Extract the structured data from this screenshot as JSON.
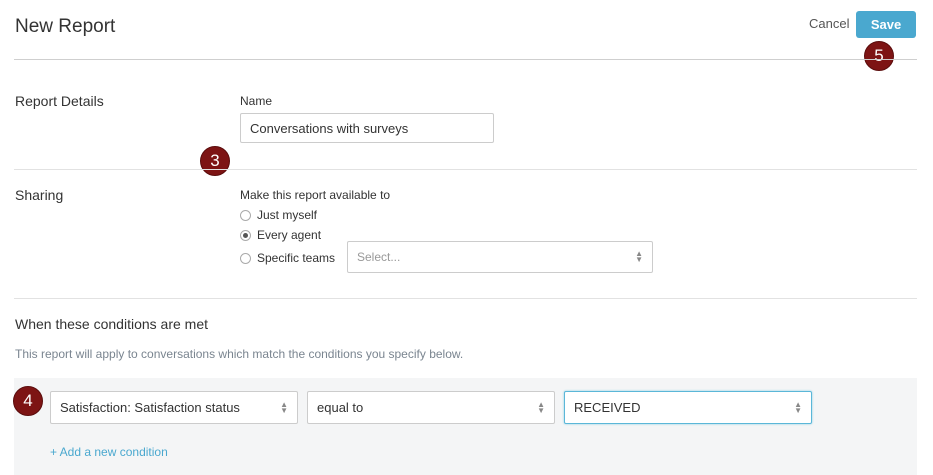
{
  "header": {
    "title": "New Report",
    "cancel_label": "Cancel",
    "save_label": "Save"
  },
  "report_details": {
    "section_label": "Report Details",
    "name_label": "Name",
    "name_value": "Conversations with surveys"
  },
  "sharing": {
    "section_label": "Sharing",
    "prompt": "Make this report available to",
    "options": [
      {
        "label": "Just myself",
        "checked": false
      },
      {
        "label": "Every agent",
        "checked": true
      },
      {
        "label": "Specific teams",
        "checked": false
      }
    ],
    "teams_select_placeholder": "Select..."
  },
  "conditions": {
    "section_label": "When these conditions are met",
    "helper_text": "This report will apply to conversations which match the conditions you specify below.",
    "rows": [
      {
        "field": "Satisfaction: Satisfaction status",
        "operator": "equal to",
        "value": "RECEIVED"
      }
    ],
    "add_label": "+ Add a new condition"
  },
  "callouts": [
    "3",
    "4",
    "5"
  ],
  "colors": {
    "accent": "#4aa8cf",
    "callout": "#7d1414"
  }
}
